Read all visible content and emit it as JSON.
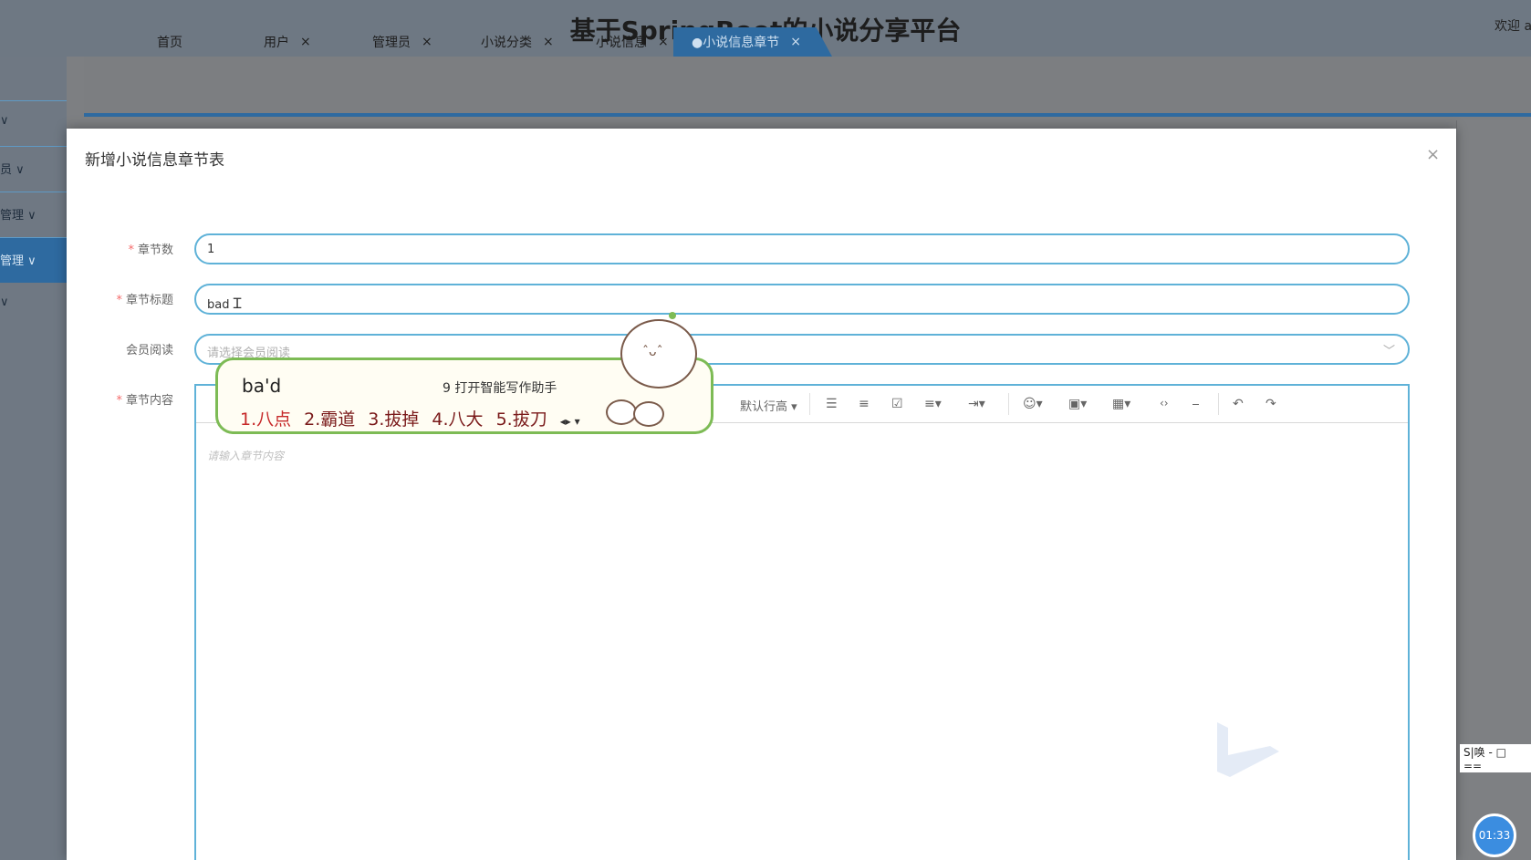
{
  "header": {
    "title": "基于SpringBoot的小说分享平台",
    "welcome": "欢迎 a"
  },
  "sidebar": {
    "items": [
      {
        "label": "∨"
      },
      {
        "label": "员 ∨"
      },
      {
        "label": "管理 ∨"
      },
      {
        "label": "管理 ∨"
      },
      {
        "label": "∨"
      }
    ]
  },
  "tabs": [
    {
      "label": "首页",
      "closable": false
    },
    {
      "label": "用户",
      "closable": true
    },
    {
      "label": "管理员",
      "closable": true
    },
    {
      "label": "小说分类",
      "closable": true
    },
    {
      "label": "小说信息",
      "closable": true
    },
    {
      "label": "●小说信息章节",
      "closable": true,
      "active": true
    }
  ],
  "close_glyph": "×",
  "modal": {
    "title": "新增小说信息章节表",
    "fields": {
      "chapter_no": {
        "label": "章节数",
        "required": true,
        "value": "1"
      },
      "chapter_title": {
        "label": "章节标题",
        "required": true,
        "value": "bad"
      },
      "member_read": {
        "label": "会员阅读",
        "required": false,
        "placeholder": "请选择会员阅读"
      },
      "chapter_content": {
        "label": "章节内容",
        "required": true,
        "placeholder": "请输入章节内容"
      }
    },
    "editor_toolbar": {
      "line_height": "默认行高"
    }
  },
  "ime": {
    "typed": "ba'd",
    "assist": "9 打开智能写作助手",
    "candidates": [
      "1.八点",
      "2.霸道",
      "3.拔掉",
      "4.八大",
      "5.拔刀"
    ],
    "nav": "◂▸ ▾"
  },
  "overlay": {
    "timer": "01:33",
    "caption": "S|唤 - □ =="
  },
  "colors": {
    "accent": "#2e6aa0",
    "input_border": "#5fb2d8",
    "ime_border": "#7dbb55",
    "required": "#f56c6c"
  }
}
